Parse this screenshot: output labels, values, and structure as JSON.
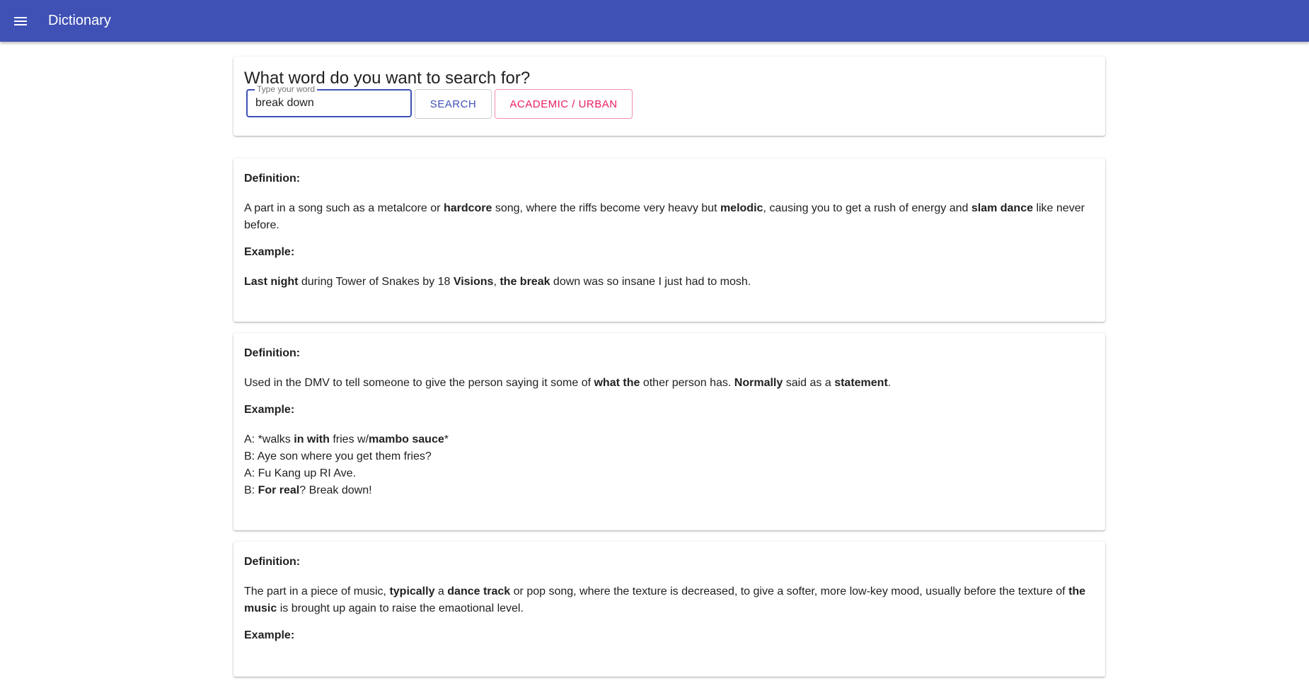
{
  "app": {
    "title": "Dictionary",
    "menu_icon": "menu-icon"
  },
  "colors": {
    "primary": "#3f51b5",
    "accent": "#e91e63"
  },
  "search": {
    "heading": "What word do you want to search for?",
    "label": "Type your word",
    "value": "break down",
    "search_button": "Search",
    "mode_button": "Academic / Urban"
  },
  "labels": {
    "definition": "Definition:",
    "example": "Example:"
  },
  "entries": [
    {
      "definition": [
        {
          "t": "A part in a song such as a metalcore or "
        },
        {
          "t": "hardcore",
          "b": true
        },
        {
          "t": " song, where the riffs become very heavy but "
        },
        {
          "t": "melodic",
          "b": true
        },
        {
          "t": ", causing you to get a rush of energy and "
        },
        {
          "t": "slam dance",
          "b": true
        },
        {
          "t": " like never before."
        }
      ],
      "example": [
        [
          {
            "t": "Last night",
            "b": true
          },
          {
            "t": " during Tower of Snakes by 18 "
          },
          {
            "t": "Visions",
            "b": true
          },
          {
            "t": ", "
          },
          {
            "t": "the break",
            "b": true
          },
          {
            "t": " down was so insane I just had to mosh."
          }
        ]
      ]
    },
    {
      "definition": [
        {
          "t": "Used in the DMV to tell someone to give the person saying it some of "
        },
        {
          "t": "what the",
          "b": true
        },
        {
          "t": " other person has. "
        },
        {
          "t": "Normally",
          "b": true
        },
        {
          "t": " said as a "
        },
        {
          "t": "statement",
          "b": true
        },
        {
          "t": "."
        }
      ],
      "example": [
        [
          {
            "t": "A: *walks "
          },
          {
            "t": "in with",
            "b": true
          },
          {
            "t": " fries w/"
          },
          {
            "t": "mambo sauce",
            "b": true
          },
          {
            "t": "*"
          }
        ],
        [
          {
            "t": "B: Aye son where you get them fries?"
          }
        ],
        [
          {
            "t": "A: Fu Kang up RI Ave."
          }
        ],
        [
          {
            "t": "B: "
          },
          {
            "t": "For real",
            "b": true
          },
          {
            "t": "? Break down!"
          }
        ]
      ]
    },
    {
      "definition": [
        {
          "t": "The part in a piece of music, "
        },
        {
          "t": "typically",
          "b": true
        },
        {
          "t": " a "
        },
        {
          "t": "dance track",
          "b": true
        },
        {
          "t": " or pop song, where the texture is decreased, to give a softer, more low-key mood, usually before the texture of "
        },
        {
          "t": "the music",
          "b": true
        },
        {
          "t": " is brought up again to raise the emaotional level."
        }
      ],
      "example": []
    }
  ]
}
